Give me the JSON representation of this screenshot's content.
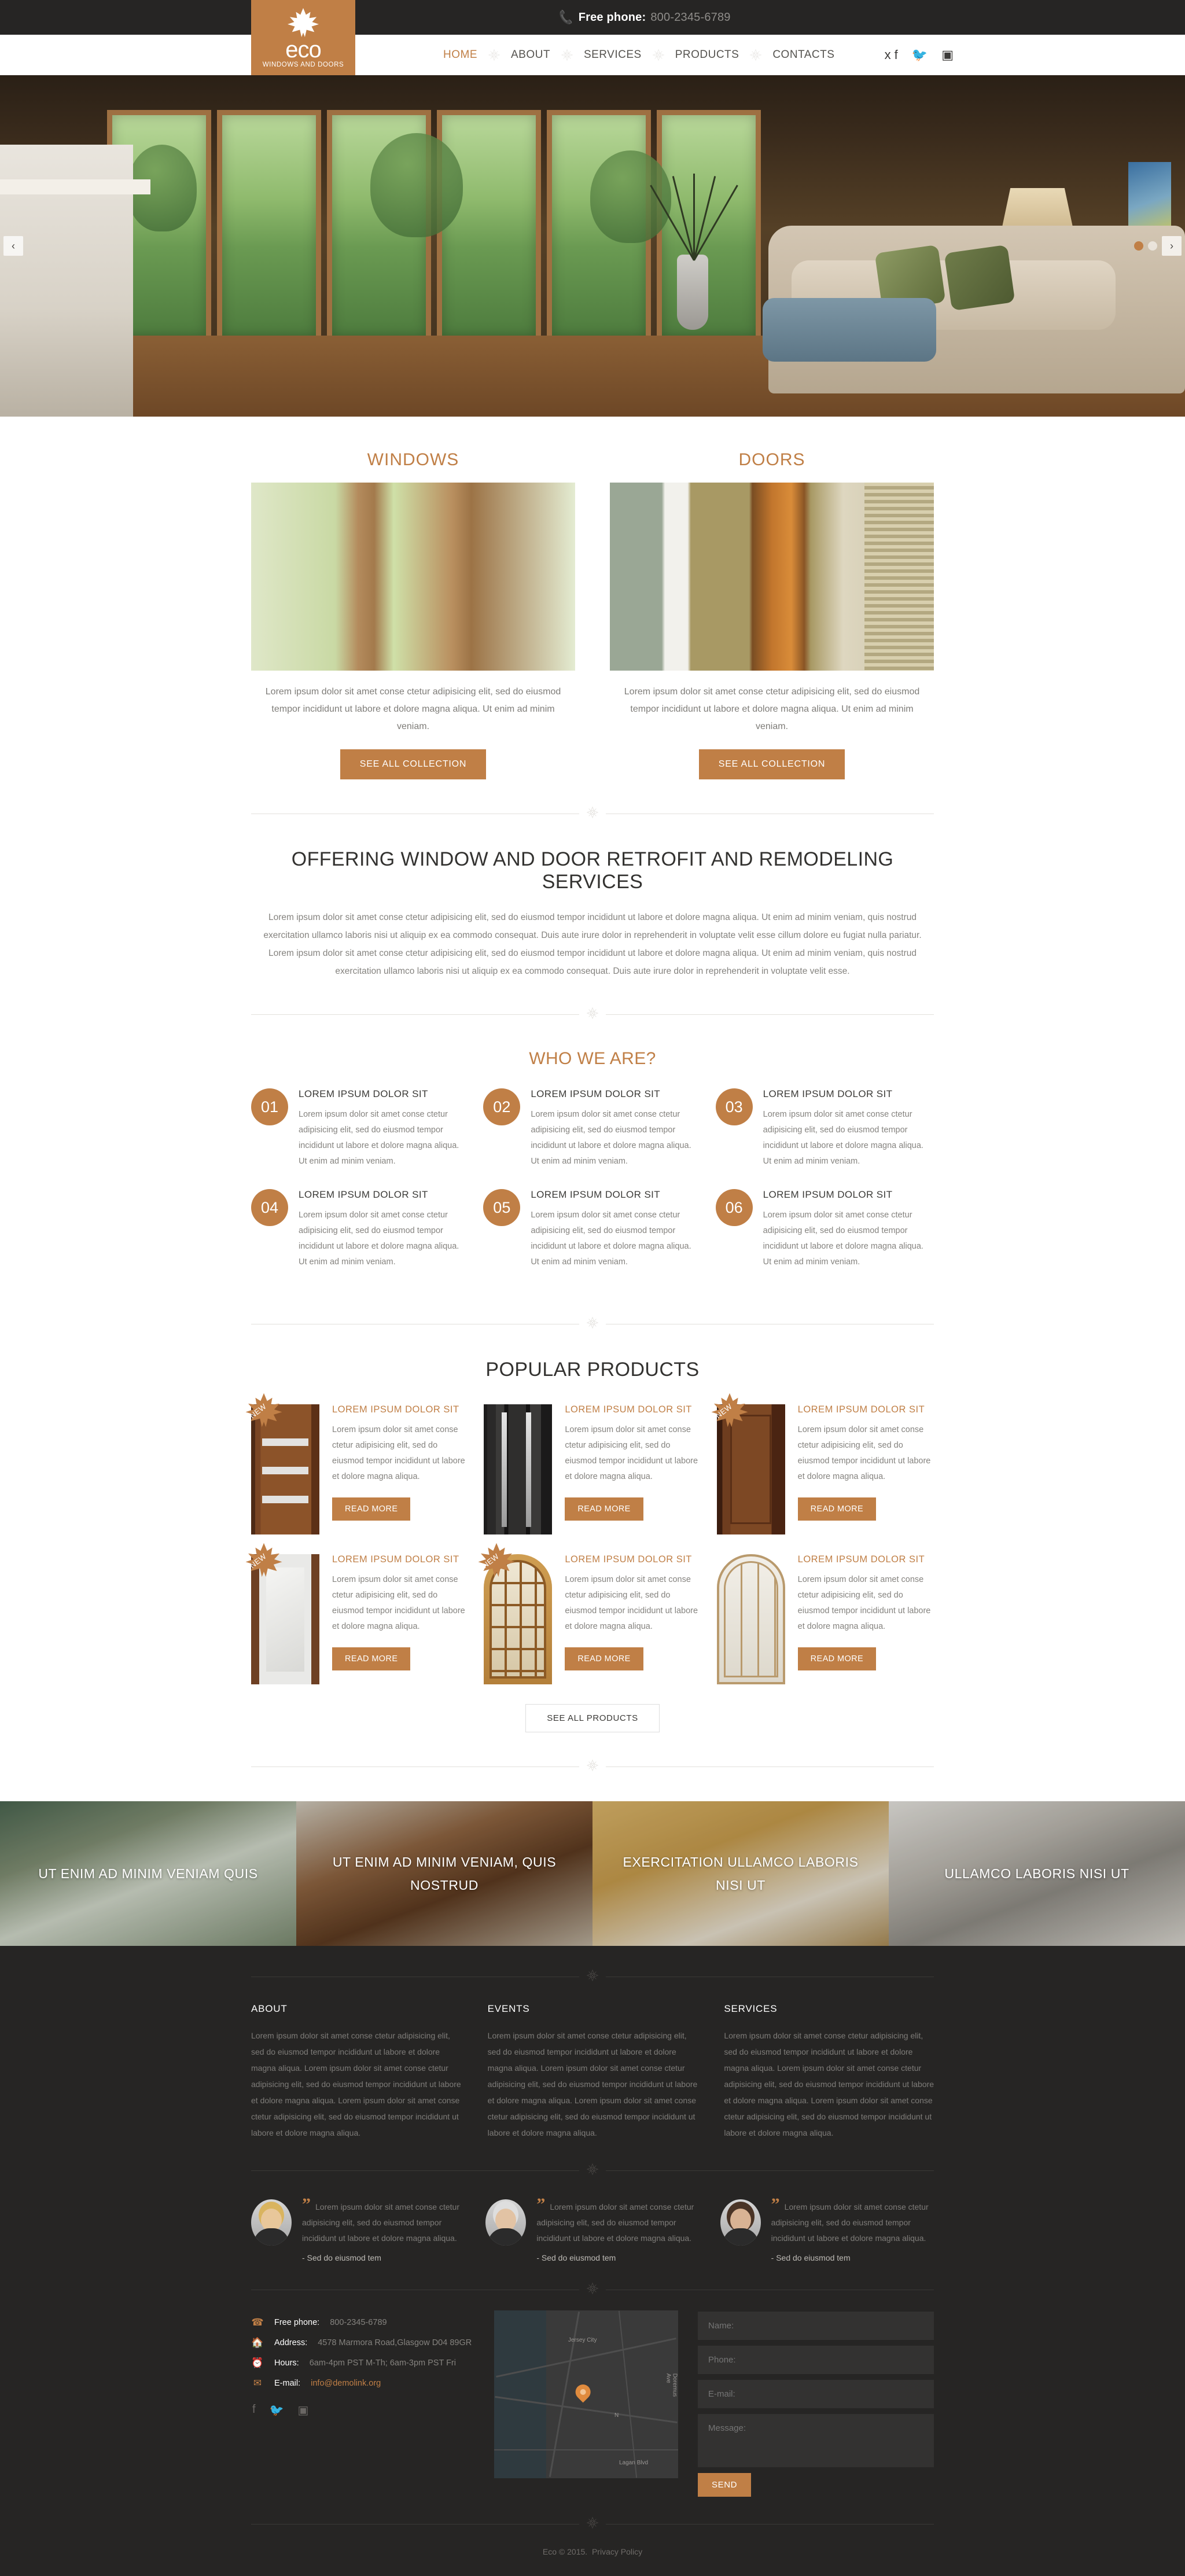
{
  "topbar": {
    "phone_label": "Free phone:",
    "phone_number": "800-2345-6789",
    "phone_icon": "phone-icon"
  },
  "logo": {
    "name": "eco",
    "tagline": "WINDOWS AND DOORS",
    "icon": "maple-leaf-icon"
  },
  "nav": {
    "items": [
      {
        "label": "HOME",
        "active": true
      },
      {
        "label": "ABOUT",
        "active": false
      },
      {
        "label": "SERVICES",
        "active": false
      },
      {
        "label": "PRODUCTS",
        "active": false
      },
      {
        "label": "CONTACTS",
        "active": false
      }
    ]
  },
  "social": [
    {
      "name": "facebook-icon",
      "glyph": "f"
    },
    {
      "name": "twitter-icon",
      "glyph": "ᵛ"
    },
    {
      "name": "instagram-icon",
      "glyph": "▣"
    }
  ],
  "hero": {
    "prev_label": "‹",
    "next_label": "›",
    "dots": 2
  },
  "categories": [
    {
      "title": "WINDOWS",
      "text": "Lorem ipsum dolor sit amet conse ctetur adipisicing elit, sed do eiusmod tempor incididunt ut labore et dolore magna aliqua. Ut enim ad minim veniam.",
      "button": "SEE ALL COLLECTION"
    },
    {
      "title": "DOORS",
      "text": "Lorem ipsum dolor sit amet conse ctetur adipisicing elit, sed do eiusmod tempor incididunt ut labore et dolore magna aliqua. Ut enim ad minim veniam.",
      "button": "SEE ALL COLLECTION"
    }
  ],
  "offering": {
    "title": "OFFERING WINDOW AND DOOR RETROFIT AND REMODELING SERVICES",
    "paragraph": "Lorem ipsum dolor sit amet conse ctetur adipisicing elit, sed do eiusmod tempor incididunt ut labore et dolore magna aliqua. Ut enim ad minim veniam, quis nostrud exercitation ullamco laboris nisi ut aliquip ex ea commodo consequat. Duis aute irure dolor in reprehenderit in voluptate velit esse cillum dolore eu fugiat nulla pariatur. Lorem ipsum dolor sit amet conse ctetur adipisicing elit, sed do eiusmod tempor incididunt ut labore et dolore magna aliqua. Ut enim ad minim veniam, quis nostrud exercitation ullamco laboris nisi ut aliquip ex ea commodo consequat. Duis aute irure dolor in reprehenderit in voluptate velit esse."
  },
  "who_we_are": {
    "title": "WHO WE ARE?",
    "features": [
      {
        "num": "01",
        "title": "LOREM IPSUM DOLOR SIT",
        "text": "Lorem ipsum dolor sit amet conse ctetur adipisicing elit, sed do eiusmod tempor incididunt ut labore et dolore magna aliqua. Ut enim ad minim veniam."
      },
      {
        "num": "02",
        "title": "LOREM IPSUM DOLOR SIT",
        "text": "Lorem ipsum dolor sit amet conse ctetur adipisicing elit, sed do eiusmod tempor incididunt ut labore et dolore magna aliqua. Ut enim ad minim veniam."
      },
      {
        "num": "03",
        "title": "LOREM IPSUM DOLOR SIT",
        "text": "Lorem ipsum dolor sit amet conse ctetur adipisicing elit, sed do eiusmod tempor incididunt ut labore et dolore magna aliqua. Ut enim ad minim veniam."
      },
      {
        "num": "04",
        "title": "LOREM IPSUM DOLOR SIT",
        "text": "Lorem ipsum dolor sit amet conse ctetur adipisicing elit, sed do eiusmod tempor incididunt ut labore et dolore magna aliqua. Ut enim ad minim veniam."
      },
      {
        "num": "05",
        "title": "LOREM IPSUM DOLOR SIT",
        "text": "Lorem ipsum dolor sit amet conse ctetur adipisicing elit, sed do eiusmod tempor incididunt ut labore et dolore magna aliqua. Ut enim ad minim veniam."
      },
      {
        "num": "06",
        "title": "LOREM IPSUM DOLOR SIT",
        "text": "Lorem ipsum dolor sit amet conse ctetur adipisicing elit, sed do eiusmod tempor incididunt ut labore et dolore magna aliqua. Ut enim ad minim veniam."
      }
    ]
  },
  "popular_products": {
    "title": "POPULAR PRODUCTS",
    "badge_label": "NEW",
    "see_all_label": "SEE ALL PRODUCTS",
    "items": [
      {
        "title": "LOREM IPSUM DOLOR SIT",
        "text": "Lorem ipsum dolor sit amet conse ctetur adipisicing elit, sed do eiusmod tempor incididunt ut labore et dolore magna aliqua.",
        "button": "READ MORE",
        "badge": true
      },
      {
        "title": "LOREM IPSUM DOLOR SIT",
        "text": "Lorem ipsum dolor sit amet conse ctetur adipisicing elit, sed do eiusmod tempor incididunt ut labore et dolore magna aliqua.",
        "button": "READ MORE",
        "badge": false
      },
      {
        "title": "LOREM IPSUM DOLOR SIT",
        "text": "Lorem ipsum dolor sit amet conse ctetur adipisicing elit, sed do eiusmod tempor incididunt ut labore et dolore magna aliqua.",
        "button": "READ MORE",
        "badge": true
      },
      {
        "title": "LOREM IPSUM DOLOR SIT",
        "text": "Lorem ipsum dolor sit amet conse ctetur adipisicing elit, sed do eiusmod tempor incididunt ut labore et dolore magna aliqua.",
        "button": "READ MORE",
        "badge": true
      },
      {
        "title": "LOREM IPSUM DOLOR SIT",
        "text": "Lorem ipsum dolor sit amet conse ctetur adipisicing elit, sed do eiusmod tempor incididunt ut labore et dolore magna aliqua.",
        "button": "READ MORE",
        "badge": true
      },
      {
        "title": "LOREM IPSUM DOLOR SIT",
        "text": "Lorem ipsum dolor sit amet conse ctetur adipisicing elit, sed do eiusmod tempor incididunt ut labore et dolore magna aliqua.",
        "button": "READ MORE",
        "badge": false
      }
    ]
  },
  "banners": [
    {
      "caption": "UT ENIM AD MINIM VENIAM QUIS"
    },
    {
      "caption": "UT ENIM AD MINIM VENIAM, QUIS NOSTRUD"
    },
    {
      "caption": "EXERCITATION ULLAMCO LABORIS NISI UT"
    },
    {
      "caption": "ULLAMCO LABORIS NISI UT"
    }
  ],
  "footer_columns": [
    {
      "heading": "ABOUT",
      "text": "Lorem ipsum dolor sit amet conse ctetur adipisicing elit, sed do eiusmod tempor incididunt ut labore et dolore magna aliqua. Lorem ipsum dolor sit amet conse ctetur adipisicing elit, sed do eiusmod tempor incididunt ut labore et dolore magna aliqua. Lorem ipsum dolor sit amet conse ctetur adipisicing elit, sed do eiusmod tempor incididunt ut labore et dolore magna aliqua."
    },
    {
      "heading": "EVENTS",
      "text": "Lorem ipsum dolor sit amet conse ctetur adipisicing elit, sed do eiusmod tempor incididunt ut labore et dolore magna aliqua. Lorem ipsum dolor sit amet conse ctetur adipisicing elit, sed do eiusmod tempor incididunt ut labore et dolore magna aliqua. Lorem ipsum dolor sit amet conse ctetur adipisicing elit, sed do eiusmod tempor incididunt ut labore et dolore magna aliqua."
    },
    {
      "heading": "SERVICES",
      "text": "Lorem ipsum dolor sit amet conse ctetur adipisicing elit, sed do eiusmod tempor incididunt ut labore et dolore magna aliqua. Lorem ipsum dolor sit amet conse ctetur adipisicing elit, sed do eiusmod tempor incididunt ut labore et dolore magna aliqua. Lorem ipsum dolor sit amet conse ctetur adipisicing elit, sed do eiusmod tempor incididunt ut labore et dolore magna aliqua."
    }
  ],
  "testimonials": [
    {
      "text": "Lorem ipsum dolor sit amet conse ctetur adipisicing elit, sed do eiusmod tempor incididunt ut labore et dolore magna aliqua.",
      "author": "- Sed do eiusmod tem"
    },
    {
      "text": "Lorem ipsum dolor sit amet conse ctetur adipisicing elit, sed do eiusmod tempor incididunt ut labore et dolore magna aliqua.",
      "author": "- Sed do eiusmod tem"
    },
    {
      "text": "Lorem ipsum dolor sit amet conse ctetur adipisicing elit, sed do eiusmod tempor incididunt ut labore et dolore magna aliqua.",
      "author": "- Sed do eiusmod tem"
    }
  ],
  "contact": {
    "phone_label": "Free phone:",
    "phone_value": "800-2345-6789",
    "address_label": "Address:",
    "address_value": "4578 Marmora Road,Glasgow D04 89GR",
    "hours_label": "Hours:",
    "hours_value": "6am-4pm PST M-Th;   6am-3pm PST Fri",
    "email_label": "E-mail:",
    "email_value": "info@demolink.org",
    "social": [
      {
        "name": "facebook-icon",
        "glyph": "f"
      },
      {
        "name": "twitter-icon",
        "glyph": "ᵛ"
      },
      {
        "name": "instagram-icon",
        "glyph": "▣"
      }
    ]
  },
  "map": {
    "labels": [
      "Jersey City",
      "N",
      "Doremus Ave",
      "Lagan Blvd"
    ]
  },
  "form": {
    "name_placeholder": "Name:",
    "phone_placeholder": "Phone:",
    "email_placeholder": "E-mail:",
    "message_placeholder": "Message:",
    "send_label": "SEND"
  },
  "copyright": {
    "text": "Eco © 2015.",
    "privacy": "Privacy Policy"
  },
  "colors": {
    "accent": "#c07f46",
    "dark": "#262524",
    "muted": "#85837f"
  }
}
